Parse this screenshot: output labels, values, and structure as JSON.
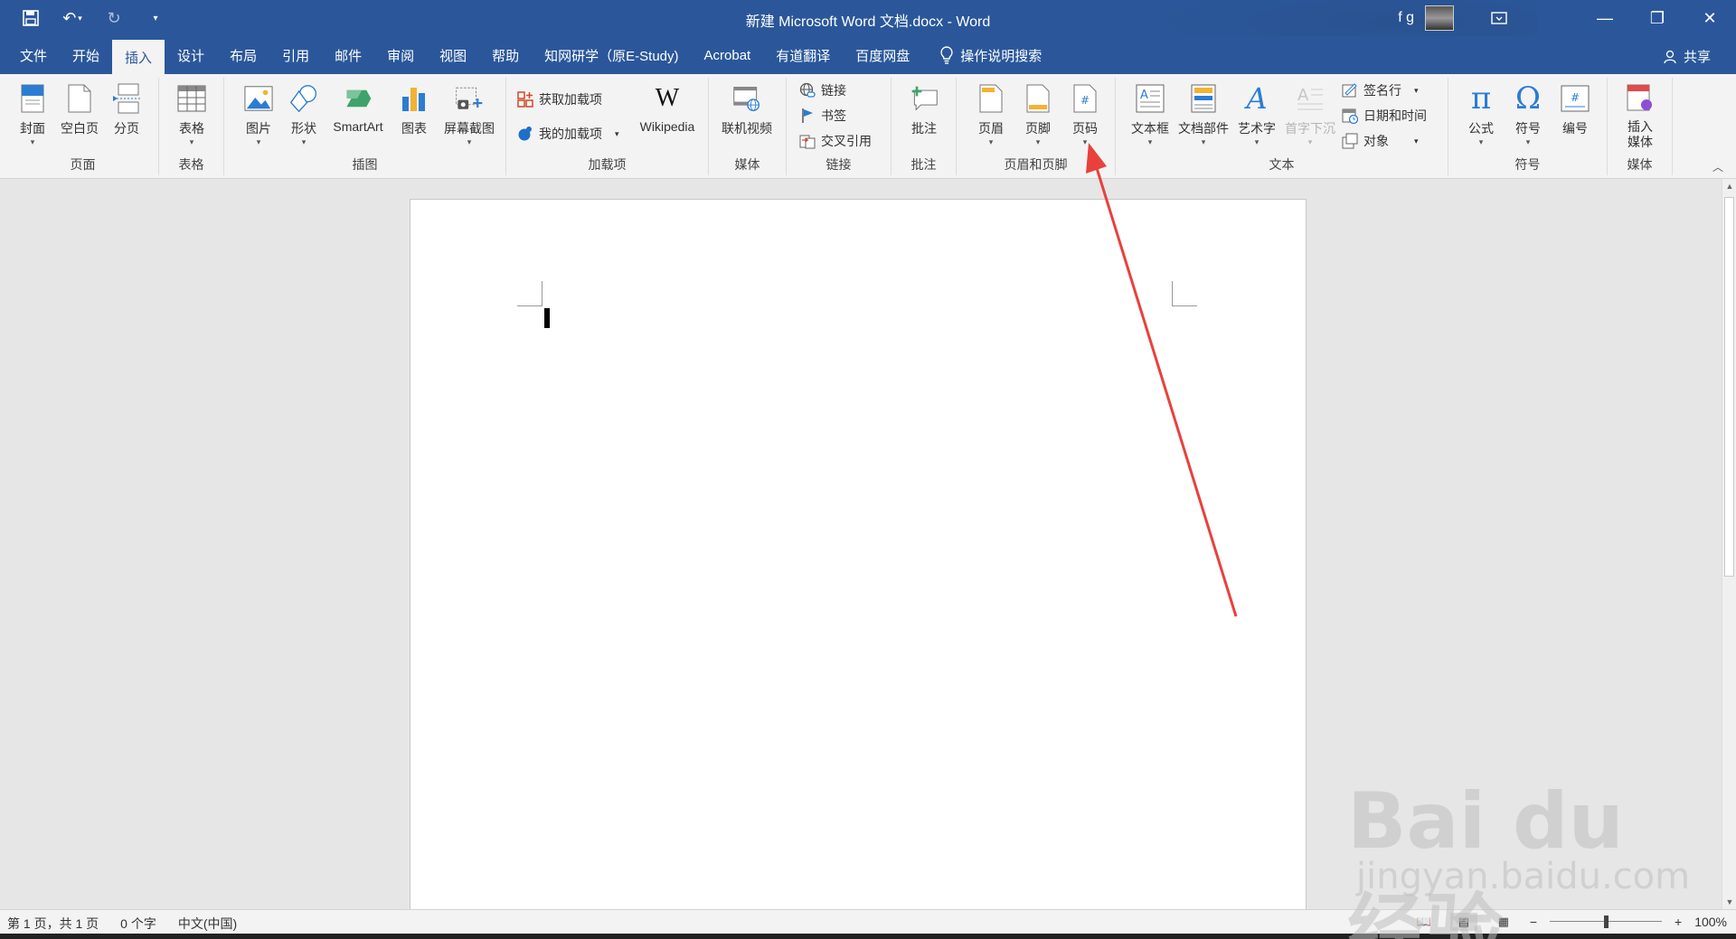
{
  "window": {
    "title": "新建 Microsoft Word 文档.docx  -  Word",
    "user_initials": "f g"
  },
  "tabs": [
    {
      "label": "文件",
      "active": false
    },
    {
      "label": "开始",
      "active": false
    },
    {
      "label": "插入",
      "active": true
    },
    {
      "label": "设计",
      "active": false
    },
    {
      "label": "布局",
      "active": false
    },
    {
      "label": "引用",
      "active": false
    },
    {
      "label": "邮件",
      "active": false
    },
    {
      "label": "审阅",
      "active": false
    },
    {
      "label": "视图",
      "active": false
    },
    {
      "label": "帮助",
      "active": false
    },
    {
      "label": "知网研学（原E-Study)",
      "active": false
    },
    {
      "label": "Acrobat",
      "active": false
    },
    {
      "label": "有道翻译",
      "active": false
    },
    {
      "label": "百度网盘",
      "active": false
    }
  ],
  "tellme": "操作说明搜索",
  "share": "共享",
  "ribbon": {
    "pages": {
      "label": "页面",
      "cover": "封面",
      "blank": "空白页",
      "break": "分页"
    },
    "tables": {
      "label": "表格",
      "table": "表格"
    },
    "illustrations": {
      "label": "插图",
      "picture": "图片",
      "shapes": "形状",
      "smartart": "SmartArt",
      "chart": "图表",
      "screenshot": "屏幕截图"
    },
    "addins": {
      "label": "加载项",
      "get": "获取加载项",
      "my": "我的加载项",
      "wikipedia": "Wikipedia"
    },
    "media1": {
      "label": "媒体",
      "video": "联机视频"
    },
    "links": {
      "label": "链接",
      "link": "链接",
      "bookmark": "书签",
      "crossref": "交叉引用"
    },
    "comments": {
      "label": "批注",
      "comment": "批注"
    },
    "headerfooter": {
      "label": "页眉和页脚",
      "header": "页眉",
      "footer": "页脚",
      "pagenum": "页码"
    },
    "text": {
      "label": "文本",
      "textbox": "文本框",
      "parts": "文档部件",
      "wordart": "艺术字",
      "dropcap": "首字下沉",
      "sigline": "签名行",
      "datetime": "日期和时间",
      "object": "对象"
    },
    "symbols": {
      "label": "符号",
      "equation": "公式",
      "symbol": "符号",
      "number": "编号"
    },
    "media2": {
      "label": "媒体",
      "insert_media": "插入\n媒体"
    }
  },
  "status": {
    "page": "第 1 页，共 1 页",
    "words": "0 个字",
    "language": "中文(中国)",
    "zoom": "100%",
    "zoom_level": 0.5
  },
  "watermark": {
    "main": "Bai du经验",
    "sub": "jingyan.baidu.com"
  },
  "colors": {
    "accent": "#2b579a",
    "annotation": "#e8413c"
  }
}
